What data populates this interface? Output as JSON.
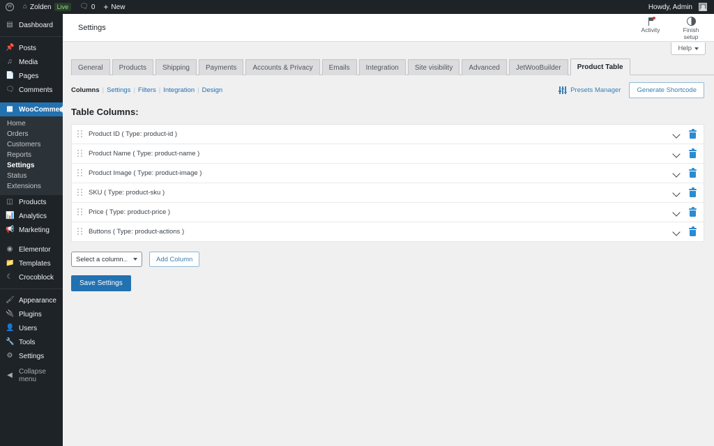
{
  "adminbar": {
    "wp_logo_icon": "wordpress-logo-icon",
    "home_icon": "home-icon",
    "site_name": "Zolden",
    "live_badge": "Live",
    "comments_icon": "comment-bubble-icon",
    "comments_count": "0",
    "new_plus": "+",
    "new_label": "New",
    "howdy": "Howdy, Admin",
    "avatar": "user-avatar"
  },
  "sidebar": {
    "items": [
      {
        "label": "Dashboard",
        "icon": "dashboard-icon",
        "glyph": "⌘"
      },
      {
        "label": "Posts",
        "icon": "pin-icon",
        "glyph": "✒"
      },
      {
        "label": "Media",
        "icon": "media-icon",
        "glyph": "♫"
      },
      {
        "label": "Pages",
        "icon": "pages-icon",
        "glyph": "▤"
      },
      {
        "label": "Comments",
        "icon": "comment-icon",
        "glyph": "⬛"
      },
      {
        "label": "WooCommerce",
        "icon": "woocommerce-icon",
        "glyph": "▣"
      },
      {
        "label": "Products",
        "icon": "products-icon",
        "glyph": "▥"
      },
      {
        "label": "Analytics",
        "icon": "analytics-icon",
        "glyph": "█"
      },
      {
        "label": "Marketing",
        "icon": "megaphone-icon",
        "glyph": "⚑"
      },
      {
        "label": "Elementor",
        "icon": "elementor-icon",
        "glyph": "ⓔ"
      },
      {
        "label": "Templates",
        "icon": "folder-icon",
        "glyph": "▰"
      },
      {
        "label": "Crocoblock",
        "icon": "crocoblock-icon",
        "glyph": "☾"
      },
      {
        "label": "Appearance",
        "icon": "brush-icon",
        "glyph": "✒"
      },
      {
        "label": "Plugins",
        "icon": "plug-icon",
        "glyph": "⚡"
      },
      {
        "label": "Users",
        "icon": "users-icon",
        "glyph": "♟"
      },
      {
        "label": "Tools",
        "icon": "wrench-icon",
        "glyph": "⚒"
      },
      {
        "label": "Settings",
        "icon": "gear-icon",
        "glyph": "⚙"
      },
      {
        "label": "Collapse menu",
        "icon": "collapse-icon",
        "glyph": "◀"
      }
    ],
    "woocommerce_submenu": [
      "Home",
      "Orders",
      "Customers",
      "Reports",
      "Settings",
      "Status",
      "Extensions"
    ],
    "active_item": "WooCommerce",
    "active_submenu": "Settings"
  },
  "header": {
    "title": "Settings",
    "actions": [
      {
        "label": "Activity",
        "icon": "flag-activity-icon"
      },
      {
        "label": "Finish setup",
        "icon": "half-circle-progress-icon"
      }
    ],
    "help_label": "Help"
  },
  "tabs": [
    {
      "label": "General",
      "active": false
    },
    {
      "label": "Products",
      "active": false
    },
    {
      "label": "Shipping",
      "active": false
    },
    {
      "label": "Payments",
      "active": false
    },
    {
      "label": "Accounts & Privacy",
      "active": false
    },
    {
      "label": "Emails",
      "active": false
    },
    {
      "label": "Integration",
      "active": false
    },
    {
      "label": "Site visibility",
      "active": false
    },
    {
      "label": "Advanced",
      "active": false
    },
    {
      "label": "JetWooBuilder",
      "active": false
    },
    {
      "label": "Product Table",
      "active": true
    }
  ],
  "subnav": {
    "items": [
      {
        "label": "Columns",
        "current": true
      },
      {
        "label": "Settings",
        "current": false
      },
      {
        "label": "Filters",
        "current": false
      },
      {
        "label": "Integration",
        "current": false
      },
      {
        "label": "Design",
        "current": false
      }
    ],
    "presets_manager_label": "Presets Manager",
    "generate_shortcode_label": "Generate Shortcode"
  },
  "content": {
    "section_title": "Table Columns:",
    "columns": [
      "Product ID ( Type: product-id )",
      "Product Name ( Type: product-name )",
      "Product Image ( Type: product-image )",
      "SKU ( Type: product-sku )",
      "Price ( Type: product-price )",
      "Buttons ( Type: product-actions )"
    ],
    "select_placeholder": "Select a column...",
    "add_column_label": "Add Column",
    "save_label": "Save Settings"
  },
  "colors": {
    "admin_dark": "#1d2327",
    "admin_submenu": "#2c3338",
    "wp_blue": "#2271b1",
    "link_blue": "#3b7fae",
    "trash_blue": "#2a8bd1",
    "bg": "#f0f0f1"
  }
}
